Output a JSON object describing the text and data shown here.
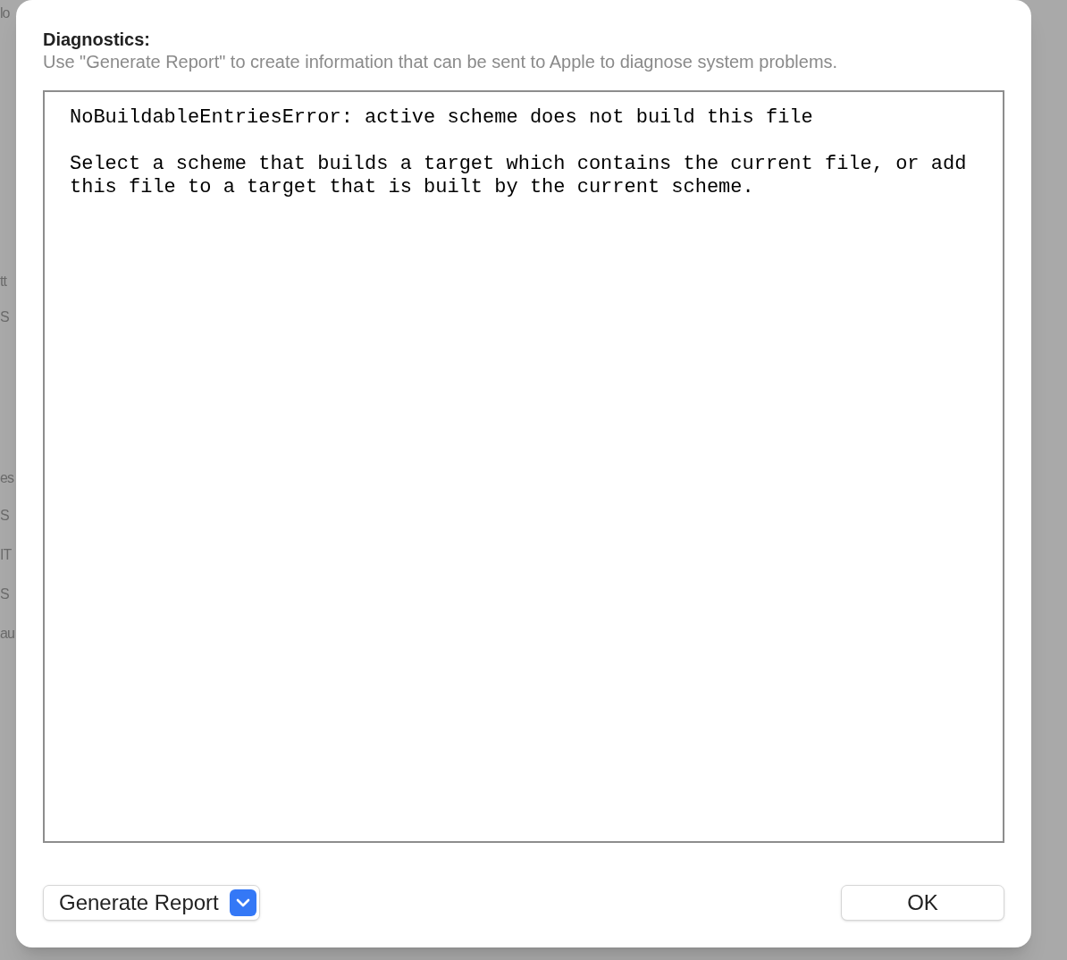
{
  "background_fragments": [
    "lo",
    "tt",
    "S",
    "es",
    "S",
    "IT",
    "S",
    "au"
  ],
  "dialog": {
    "heading": "Diagnostics:",
    "description": "Use \"Generate Report\" to create information that can be sent to Apple to diagnose system problems.",
    "log_paragraphs": [
      "NoBuildableEntriesError: active scheme does not build this file",
      "Select a scheme that builds a target which contains the current file, or add this file to a target that is built by the current scheme."
    ],
    "report_button": {
      "label": "Generate Report"
    },
    "ok_button": {
      "label": "OK"
    }
  }
}
